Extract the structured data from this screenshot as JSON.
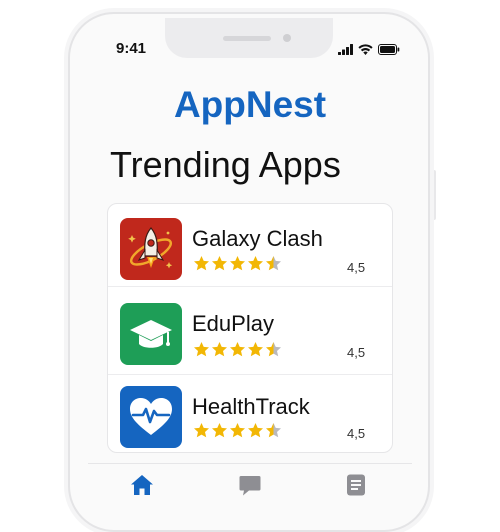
{
  "status_bar": {
    "time": "9:41"
  },
  "brand": {
    "title": "AppNest",
    "color": "#1565c0"
  },
  "section": {
    "heading": "Trending Apps"
  },
  "apps": [
    {
      "name": "Galaxy Clash",
      "rating": "4,5",
      "stars": 4.5,
      "icon": "rocket-icon",
      "icon_color": "#c62828"
    },
    {
      "name": "EduPlay",
      "rating": "4,5",
      "stars": 4.5,
      "icon": "graduation-cap-icon",
      "icon_color": "#1e9e57"
    },
    {
      "name": "HealthTrack",
      "rating": "4,5",
      "stars": 4.5,
      "icon": "heart-pulse-icon",
      "icon_color": "#1565c0"
    }
  ],
  "tab_bar": {
    "tabs": [
      {
        "icon": "home-icon",
        "active": true
      },
      {
        "icon": "chat-icon",
        "active": false
      },
      {
        "icon": "document-icon",
        "active": false
      }
    ]
  },
  "colors": {
    "star": "#f2b705",
    "star_empty": "#b9b9bd",
    "tab_active": "#1565c0",
    "tab_inactive": "#8e8e93"
  }
}
